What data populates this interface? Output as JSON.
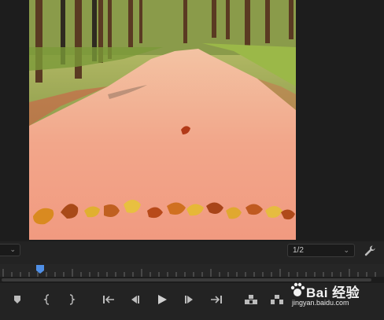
{
  "program_monitor": {
    "frame_description_icon": "forest-road-autumn-leaves-image",
    "zoom_select": {
      "value": ""
    },
    "resolution_select": {
      "value": "1/2"
    },
    "settings_icon": "wrench-icon"
  },
  "timeline": {
    "playhead_fraction": 0.105
  },
  "transport_controls": [
    {
      "name": "add-marker-button",
      "icon": "marker-icon"
    },
    {
      "name": "mark-in-button",
      "icon": "mark-in-icon"
    },
    {
      "name": "mark-out-button",
      "icon": "mark-out-icon"
    },
    {
      "name": "go-to-in-button",
      "icon": "go-to-in-icon"
    },
    {
      "name": "step-back-button",
      "icon": "step-back-icon"
    },
    {
      "name": "play-button",
      "icon": "play-icon"
    },
    {
      "name": "step-forward-button",
      "icon": "step-forward-icon"
    },
    {
      "name": "go-to-out-button",
      "icon": "go-to-out-icon"
    },
    {
      "name": "lift-button",
      "icon": "lift-icon"
    },
    {
      "name": "extract-button",
      "icon": "extract-icon"
    }
  ],
  "watermark": {
    "brand": "Bai 经验",
    "url": "jingyan.baidu.com"
  },
  "colors": {
    "background": "#232323",
    "playhead": "#4f8fe6",
    "road": "#f2a48a"
  }
}
